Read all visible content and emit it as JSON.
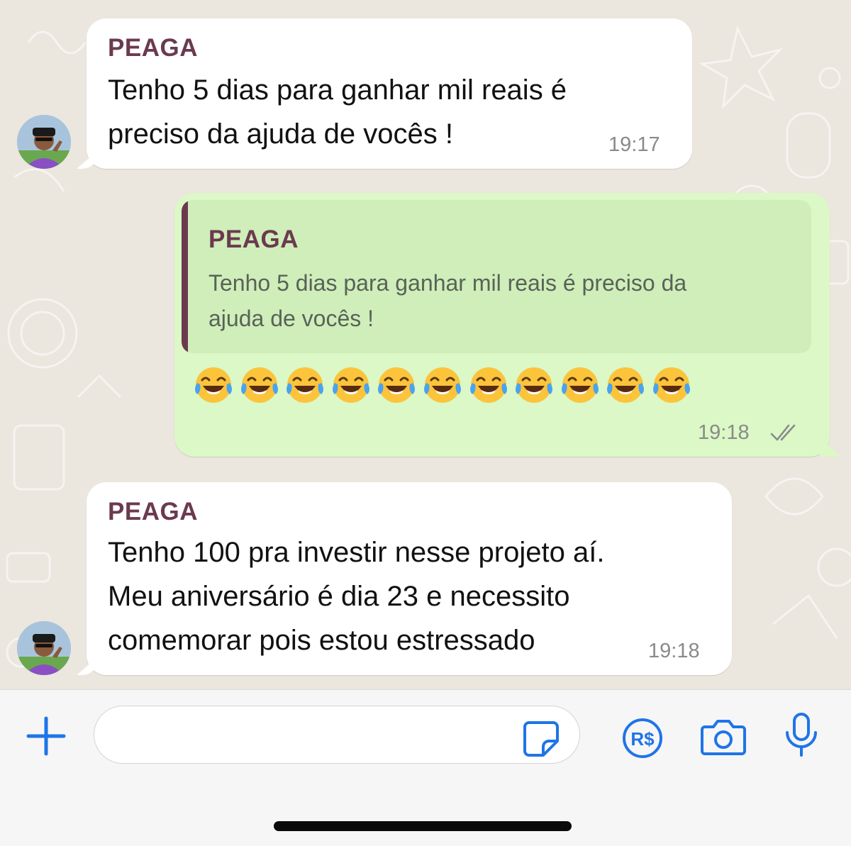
{
  "messages": [
    {
      "sender": "PEAGA",
      "text": "Tenho 5 dias para ganhar mil reais é\npreciso da ajuda de vocês !",
      "time": "19:17"
    },
    {
      "quoted_sender": "PEAGA",
      "quoted_text": "Tenho 5 dias para ganhar mil reais é preciso da\najuda de vocês !",
      "emojis": [
        "😂",
        "😂",
        "😂",
        "😂",
        "😂",
        "😂",
        "😂",
        "😂",
        "😂",
        "😂",
        "😂"
      ],
      "time": "19:18",
      "status": "read-double-check"
    },
    {
      "sender": "PEAGA",
      "text": "Tenho 100 pra investir nesse projeto aí.\nMeu aniversário é dia 23 e necessito\ncomemorar pois estou estressado",
      "time": "19:18"
    }
  ],
  "composer": {
    "input_value": "",
    "input_placeholder": "",
    "icons": [
      "plus-icon",
      "sticker-icon",
      "pix-payment-icon",
      "camera-icon",
      "microphone-icon"
    ],
    "accent_color": "#1f74e8"
  },
  "colors": {
    "chat_background": "#ebe6de",
    "incoming_bubble": "#ffffff",
    "outgoing_bubble": "#dbf8c6",
    "sender_name": "#6b3a4f"
  }
}
